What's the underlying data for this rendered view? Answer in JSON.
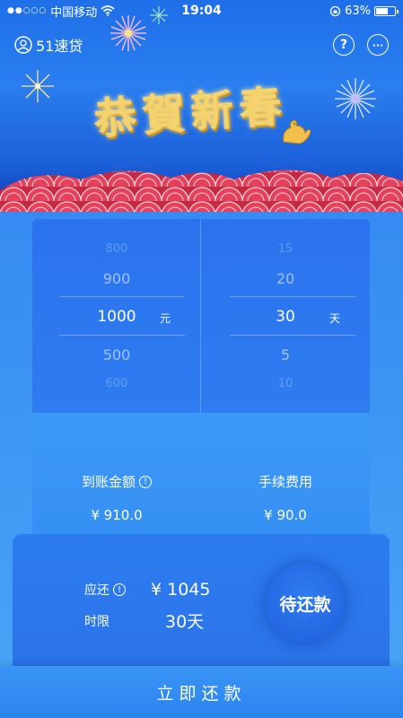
{
  "status_bar": {
    "carrier": "中国移动",
    "time": "19:04",
    "battery": "63%"
  },
  "nav": {
    "app_name": "51速贷",
    "help_label": "?",
    "more_label": "···"
  },
  "banner": {
    "title": "恭賀新春"
  },
  "picker": {
    "amount": {
      "options": [
        "800",
        "900",
        "1000",
        "500",
        "600"
      ],
      "unit": "元"
    },
    "days": {
      "options": [
        "15",
        "20",
        "30",
        "5",
        "10"
      ],
      "unit": "天"
    }
  },
  "summary": {
    "received_label": "到账金额",
    "received_value": "¥ 910.0",
    "fee_label": "手续费用",
    "fee_value": "¥ 90.0"
  },
  "repay": {
    "due_label": "应还",
    "due_value": "¥ 1045",
    "term_label": "时限",
    "term_value": "30天",
    "status_button": "待还款"
  },
  "footer": {
    "action_label": "立即还款"
  },
  "colors": {
    "primary": "#2c7def",
    "gold": "#f5d36b",
    "wave_red": "#d8324a"
  }
}
